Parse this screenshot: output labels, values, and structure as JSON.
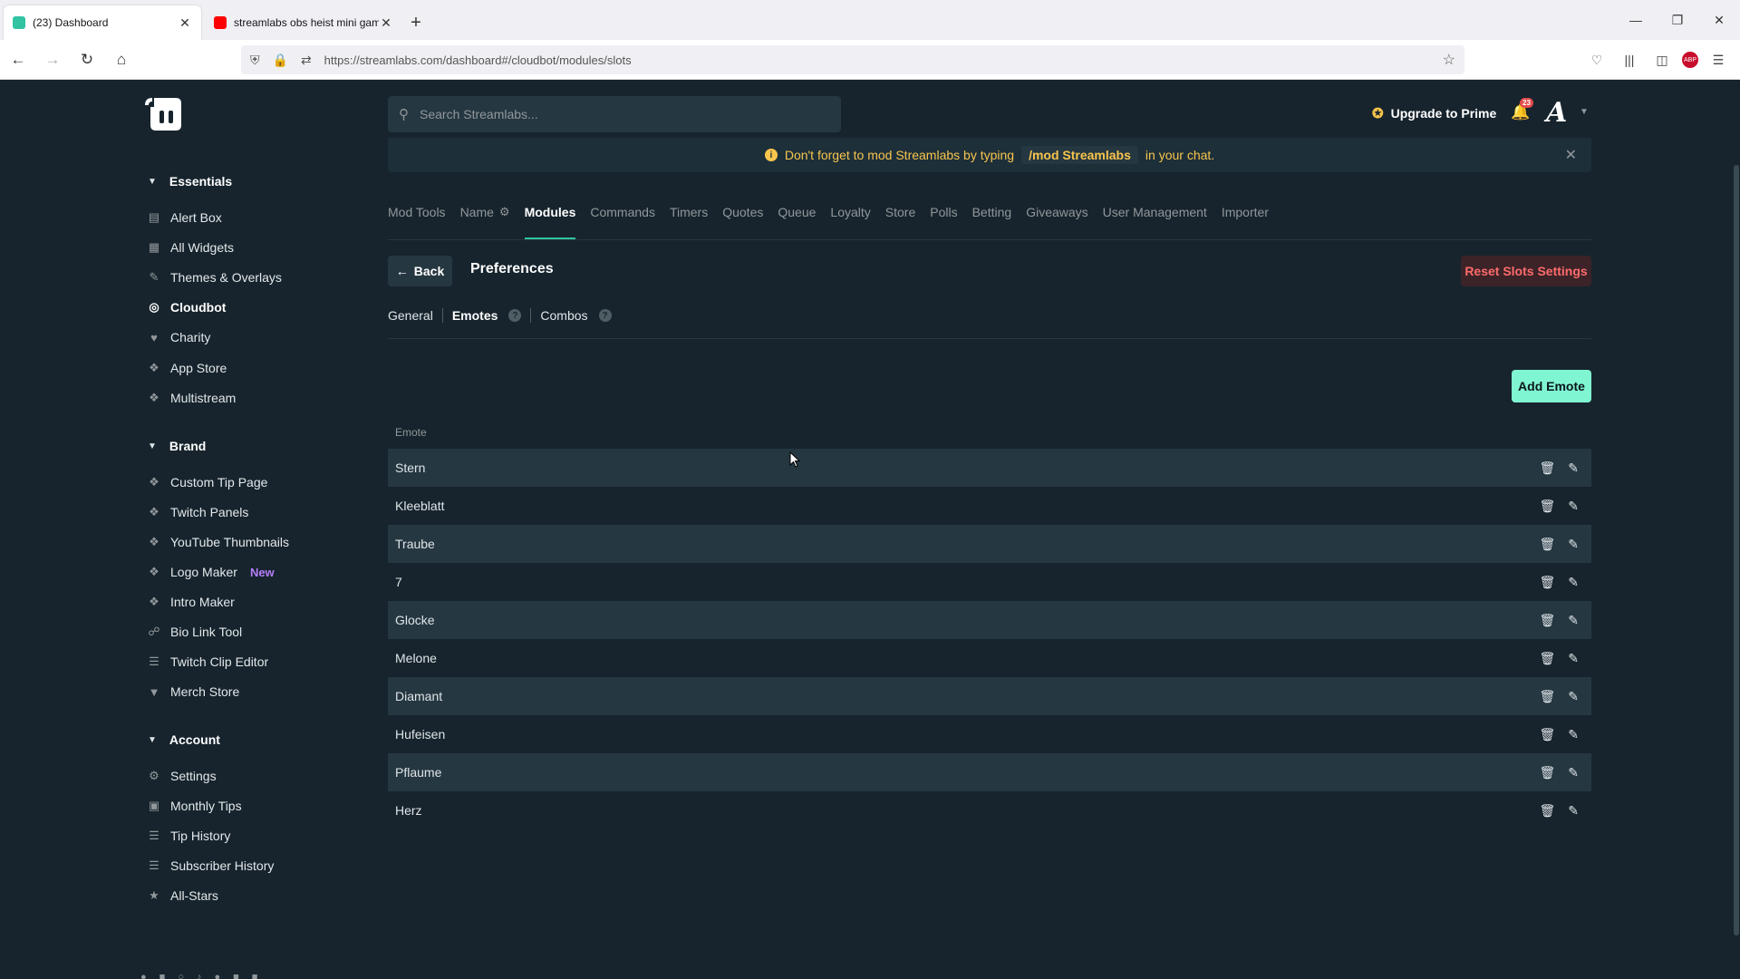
{
  "browser": {
    "tabs": [
      {
        "title": "(23) Dashboard",
        "favicon_color": "#31c3a2",
        "active": true
      },
      {
        "title": "streamlabs obs heist mini game",
        "favicon_color": "#ff0000",
        "active": false
      }
    ],
    "new_tab": "+",
    "url": "https://streamlabs.com/dashboard#/cloudbot/modules/slots"
  },
  "sidebar": {
    "sections": [
      {
        "title": "Essentials",
        "items": [
          {
            "label": "Alert Box",
            "icon": "alert-box-icon"
          },
          {
            "label": "All Widgets",
            "icon": "widgets-icon"
          },
          {
            "label": "Themes & Overlays",
            "icon": "themes-icon"
          },
          {
            "label": "Cloudbot",
            "icon": "cloudbot-icon",
            "active": true
          },
          {
            "label": "Charity",
            "icon": "heart-icon"
          },
          {
            "label": "App Store",
            "icon": "app-store-icon"
          },
          {
            "label": "Multistream",
            "icon": "multistream-icon"
          }
        ]
      },
      {
        "title": "Brand",
        "items": [
          {
            "label": "Custom Tip Page",
            "icon": "tip-page-icon"
          },
          {
            "label": "Twitch Panels",
            "icon": "panels-icon"
          },
          {
            "label": "YouTube Thumbnails",
            "icon": "thumbnails-icon"
          },
          {
            "label": "Logo Maker",
            "icon": "logo-maker-icon",
            "badge": "New"
          },
          {
            "label": "Intro Maker",
            "icon": "intro-maker-icon"
          },
          {
            "label": "Bio Link Tool",
            "icon": "link-icon"
          },
          {
            "label": "Twitch Clip Editor",
            "icon": "clip-editor-icon"
          },
          {
            "label": "Merch Store",
            "icon": "shirt-icon"
          }
        ]
      },
      {
        "title": "Account",
        "items": [
          {
            "label": "Settings",
            "icon": "gear-icon"
          },
          {
            "label": "Monthly Tips",
            "icon": "calendar-icon"
          },
          {
            "label": "Tip History",
            "icon": "list-icon"
          },
          {
            "label": "Subscriber History",
            "icon": "list-icon"
          },
          {
            "label": "All-Stars",
            "icon": "star-icon"
          }
        ]
      }
    ]
  },
  "topbar": {
    "search_placeholder": "Search Streamlabs...",
    "upgrade_label": "Upgrade to Prime",
    "notification_count": "23"
  },
  "notice": {
    "before": "Don't forget to mod Streamlabs by typing",
    "code": "/mod Streamlabs",
    "after": "in your chat."
  },
  "module_tabs": [
    {
      "label": "Mod Tools"
    },
    {
      "label": "Name",
      "gear": true
    },
    {
      "label": "Modules",
      "active": true
    },
    {
      "label": "Commands"
    },
    {
      "label": "Timers"
    },
    {
      "label": "Quotes"
    },
    {
      "label": "Queue"
    },
    {
      "label": "Loyalty"
    },
    {
      "label": "Store"
    },
    {
      "label": "Polls"
    },
    {
      "label": "Betting"
    },
    {
      "label": "Giveaways"
    },
    {
      "label": "User Management"
    },
    {
      "label": "Importer"
    }
  ],
  "preferences": {
    "back_label": "Back",
    "title": "Preferences",
    "reset_label": "Reset Slots Settings",
    "subtabs": [
      {
        "label": "General"
      },
      {
        "label": "Emotes",
        "active": true,
        "help": true
      },
      {
        "label": "Combos",
        "help": true
      }
    ],
    "add_label": "Add Emote",
    "column_header": "Emote",
    "emotes": [
      "Stern",
      "Kleeblatt",
      "Traube",
      "7",
      "Glocke",
      "Melone",
      "Diamant",
      "Hufeisen",
      "Pflaume",
      "Herz"
    ]
  },
  "colors": {
    "background": "#17242d",
    "row_alt": "#253741",
    "accent": "#80f5d2",
    "danger": "#ff6b6b",
    "warning": "#f8c54d",
    "new_badge": "#b57dfa"
  }
}
